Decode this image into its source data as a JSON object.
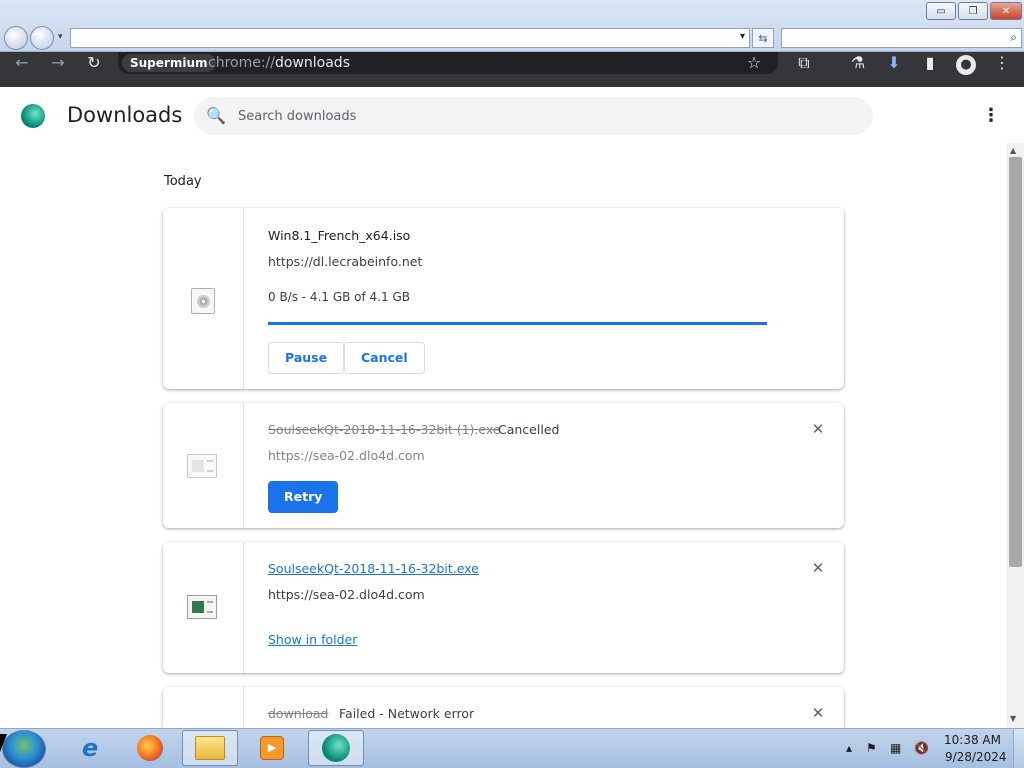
{
  "ie_frame": {
    "minimize_glyph": "▭",
    "restore_glyph": "❐",
    "close_glyph": "✕",
    "refresh_glyph": "⇆",
    "search_glyph": "⌕"
  },
  "toolbar": {
    "back_glyph": "←",
    "forward_glyph": "→",
    "reload_glyph": "↻",
    "site_chip": "Supermium",
    "url_scheme": "chrome://",
    "url_path": "downloads",
    "bookmark_glyph": "☆",
    "extensions_glyph": "⧉",
    "labs_glyph": "⚗",
    "downloads_glyph": "⬇",
    "sidepanel_glyph": "▮",
    "profile_glyph": "●",
    "menu_glyph": "⋮"
  },
  "header": {
    "title": "Downloads",
    "search_placeholder": "Search downloads",
    "search_glyph": "🔍",
    "menu_glyph": "⋮"
  },
  "scrollbar": {
    "up_glyph": "▲",
    "down_glyph": "▼"
  },
  "downloads": {
    "section_label": "Today",
    "items": [
      {
        "file_name": "Win8.1_French_x64.iso",
        "source_url": "https://dl.lecrabeinfo.net",
        "progress_text": "0 B/s - 4.1 GB of 4.1 GB",
        "progress_fraction": 1.0,
        "pause_label": "Pause",
        "cancel_label": "Cancel"
      },
      {
        "file_name": "SoulseekQt-2018-11-16-32bit (1).exe",
        "status": "Cancelled",
        "source_url": "https://sea-02.dlo4d.com",
        "retry_label": "Retry",
        "remove_glyph": "✕"
      },
      {
        "file_name": "SoulseekQt-2018-11-16-32bit.exe",
        "source_url": "https://sea-02.dlo4d.com",
        "show_in_folder_label": "Show in folder",
        "remove_glyph": "✕"
      },
      {
        "file_name": "download",
        "status": "Failed - Network error",
        "remove_glyph": "✕"
      }
    ]
  },
  "taskbar": {
    "media_glyph": "▶",
    "ie_glyph": "e",
    "tray_expand_glyph": "▴",
    "tray_flag_glyph": "⚑",
    "tray_network_glyph": "▦",
    "tray_volume_glyph": "🔇",
    "clock_time": "10:38 AM",
    "clock_date": "9/28/2024"
  },
  "colors": {
    "accent": "#1a73e8",
    "toolbar_bg": "#35363a",
    "progress_track": "#d2e3fc"
  }
}
